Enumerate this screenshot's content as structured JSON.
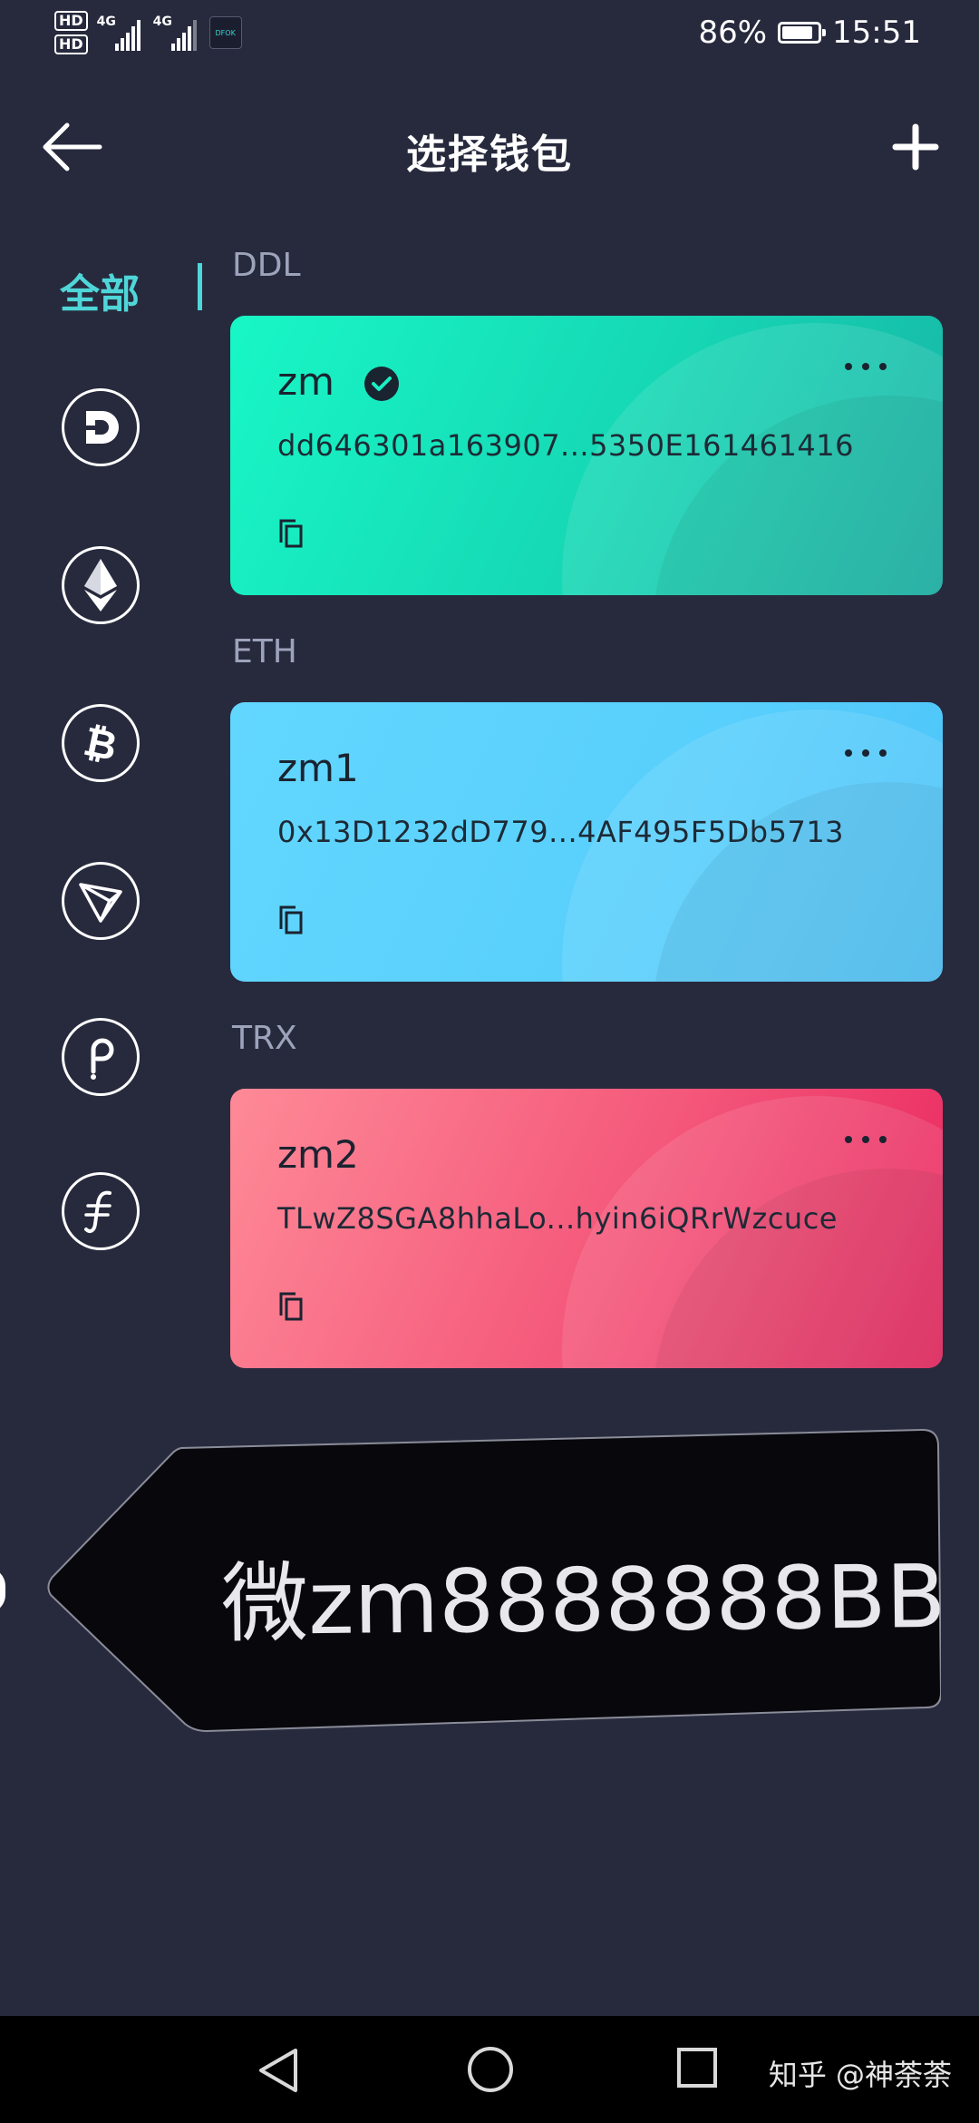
{
  "status_bar": {
    "hd1": "HD",
    "hd2": "HD",
    "net1": "4G",
    "net2": "4G",
    "app_badge": "DFOK",
    "battery_percent_text": "86%",
    "battery_level": 0.86,
    "time": "15:51"
  },
  "header": {
    "title": "选择钱包"
  },
  "rail": {
    "all_label": "全部",
    "coins": [
      "ddl-coin-icon",
      "eth-coin-icon",
      "btc-coin-icon",
      "trx-coin-icon",
      "dot-coin-icon",
      "fil-coin-icon"
    ]
  },
  "wallets": [
    {
      "chain": "DDL",
      "name": "zm",
      "selected": true,
      "address": "dd646301a163907...5350E161461416"
    },
    {
      "chain": "ETH",
      "name": "zm1",
      "selected": false,
      "address": "0x13D1232dD779...4AF495F5Db5713"
    },
    {
      "chain": "TRX",
      "name": "zm2",
      "selected": false,
      "address": "TLwZ8SGA8hhaLo...hyin6iQRrWzcuce"
    }
  ],
  "banner": {
    "text": "微zm8888888BB"
  },
  "watermark": "知乎 @神荼荼",
  "colors": {
    "background": "#272a3d",
    "accent": "#4fd6d8",
    "ddl_card": "#16d7b4",
    "eth_card": "#58cffc",
    "trx_card": "#f4577a"
  }
}
